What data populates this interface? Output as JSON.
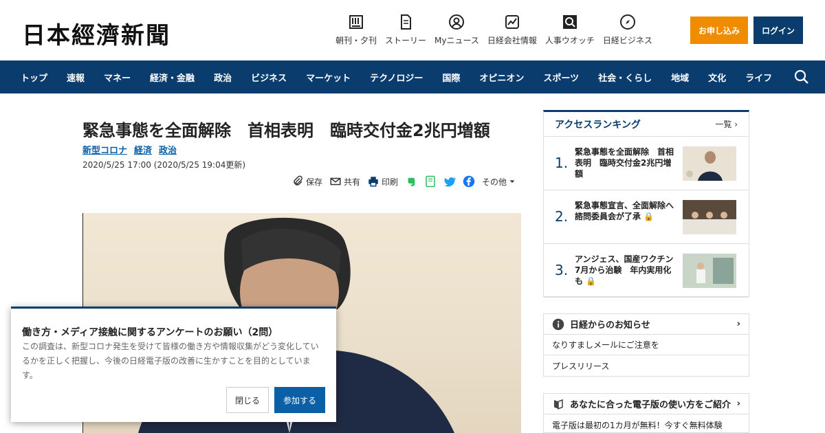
{
  "site": {
    "logo": "日本經濟新聞"
  },
  "header": {
    "tools": [
      {
        "label": "朝刊・夕刊",
        "icon": "newspaper-icon"
      },
      {
        "label": "ストーリー",
        "icon": "document-icon"
      },
      {
        "label": "Myニュース",
        "icon": "user-circle-icon"
      },
      {
        "label": "日経会社情報",
        "icon": "chart-icon"
      },
      {
        "label": "人事ウオッチ",
        "icon": "search-icon"
      },
      {
        "label": "日経ビジネス",
        "icon": "compass-icon"
      }
    ],
    "apply_label": "お申し込み",
    "login_label": "ログイン"
  },
  "nav": {
    "items": [
      "トップ",
      "速報",
      "マネー",
      "経済・金融",
      "政治",
      "ビジネス",
      "マーケット",
      "テクノロジー",
      "国際",
      "オピニオン",
      "スポーツ",
      "社会・くらし",
      "地域",
      "文化",
      "ライフ"
    ]
  },
  "article": {
    "headline": "緊急事態を全面解除　首相表明　臨時交付金2兆円増額",
    "tags": [
      "新型コロナ",
      "経済",
      "政治"
    ],
    "dateline": "2020/5/25 17:00 (2020/5/25 19:04更新)",
    "share": {
      "save": "保存",
      "share": "共有",
      "print": "印刷",
      "more": "その他"
    }
  },
  "ranking": {
    "title": "アクセスランキング",
    "more": "一覧",
    "items": [
      {
        "num": "1.",
        "title": "緊急事態を全面解除　首相表明　臨時交付金2兆円増額"
      },
      {
        "num": "2.",
        "title": "緊急事態宣言、全面解除へ　諮問委員会が了承"
      },
      {
        "num": "3.",
        "title": "アンジェス、国産ワクチン7月から治験　年内実用化も"
      }
    ]
  },
  "notices": {
    "title": "日経からのお知らせ",
    "items": [
      "なりすましメールにご注意を",
      "プレスリリース"
    ]
  },
  "guide": {
    "title": "あなたに合った電子版の使い方をご紹介",
    "text": "電子版は最初の1カ月が無料！今すぐ無料体験"
  },
  "survey": {
    "title": "働き方・メディア接触に関するアンケートのお願い（2問）",
    "body": "この調査は、新型コロナ発生を受けて皆様の働き方や情報収集がどう変化しているかを正しく把握し、今後の日経電子版の改善に生かすことを目的としています。",
    "close_label": "閉じる",
    "join_label": "参加する"
  },
  "colors": {
    "navy": "#0a3d6e",
    "orange": "#f08c00",
    "link": "#0a5fa6"
  }
}
